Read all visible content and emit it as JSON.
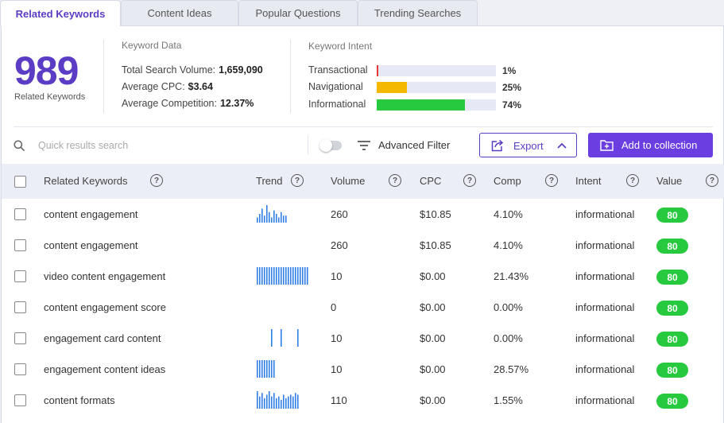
{
  "tabs": [
    {
      "label": "Related Keywords",
      "active": true
    },
    {
      "label": "Content Ideas",
      "active": false
    },
    {
      "label": "Popular Questions",
      "active": false
    },
    {
      "label": "Trending Searches",
      "active": false
    }
  ],
  "summary": {
    "count": "989",
    "count_label": "Related Keywords"
  },
  "keyword_data": {
    "title": "Keyword Data",
    "rows": [
      {
        "label": "Total Search Volume:",
        "value": "1,659,090"
      },
      {
        "label": "Average CPC:",
        "value": "$3.64"
      },
      {
        "label": "Average Competition:",
        "value": "12.37%"
      }
    ]
  },
  "keyword_intent": {
    "title": "Keyword Intent",
    "rows": [
      {
        "label": "Transactional",
        "percent": "1%",
        "value": 1,
        "color": "#e53935"
      },
      {
        "label": "Navigational",
        "percent": "25%",
        "value": 25,
        "color": "#f5b800"
      },
      {
        "label": "Informational",
        "percent": "74%",
        "value": 74,
        "color": "#27c93f"
      }
    ]
  },
  "toolbar": {
    "search_placeholder": "Quick results search",
    "advanced_filter": "Advanced Filter",
    "export": "Export",
    "add_to_collection": "Add to collection"
  },
  "table": {
    "columns": {
      "keyword": "Related Keywords",
      "trend": "Trend",
      "volume": "Volume",
      "cpc": "CPC",
      "comp": "Comp",
      "intent": "Intent",
      "value": "Value"
    },
    "rows": [
      {
        "keyword": "content engagement",
        "trend": [
          0.3,
          0.5,
          0.8,
          0.4,
          1.0,
          0.6,
          0.3,
          0.7,
          0.5,
          0.3,
          0.6,
          0.4,
          0.4
        ],
        "volume": "260",
        "cpc": "$10.85",
        "comp": "4.10%",
        "intent": "informational",
        "value": "80"
      },
      {
        "keyword": "content engagement",
        "trend": [],
        "volume": "260",
        "cpc": "$10.85",
        "comp": "4.10%",
        "intent": "informational",
        "value": "80"
      },
      {
        "keyword": "video content engagement",
        "trend": [
          1,
          1,
          1,
          1,
          1,
          1,
          1,
          1,
          1,
          1,
          1,
          1,
          1,
          1,
          1,
          1,
          1,
          1,
          1,
          1,
          1,
          1
        ],
        "volume": "10",
        "cpc": "$0.00",
        "comp": "21.43%",
        "intent": "informational",
        "value": "80"
      },
      {
        "keyword": "content engagement score",
        "trend": [],
        "volume": "0",
        "cpc": "$0.00",
        "comp": "0.00%",
        "intent": "informational",
        "value": "80"
      },
      {
        "keyword": "engagement card content",
        "trend": [
          0,
          0,
          0,
          0,
          0,
          0,
          1,
          0,
          0,
          0,
          1,
          0,
          0,
          0,
          0,
          0,
          0,
          1,
          0,
          0,
          0,
          0
        ],
        "volume": "10",
        "cpc": "$0.00",
        "comp": "0.00%",
        "intent": "informational",
        "value": "80"
      },
      {
        "keyword": "engagement content ideas",
        "trend": [
          1,
          1,
          1,
          1,
          1,
          1,
          1,
          1,
          0,
          0,
          0,
          0,
          0,
          0,
          0,
          0,
          0,
          0,
          0,
          0,
          0,
          0
        ],
        "volume": "10",
        "cpc": "$0.00",
        "comp": "28.57%",
        "intent": "informational",
        "value": "80"
      },
      {
        "keyword": "content formats",
        "trend": [
          1.0,
          0.7,
          0.9,
          0.6,
          0.8,
          1.0,
          0.7,
          0.9,
          0.6,
          0.7,
          0.5,
          0.8,
          0.6,
          0.7,
          0.8,
          0.7,
          0.9,
          0.8
        ],
        "volume": "110",
        "cpc": "$0.00",
        "comp": "1.55%",
        "intent": "informational",
        "value": "80"
      }
    ]
  }
}
